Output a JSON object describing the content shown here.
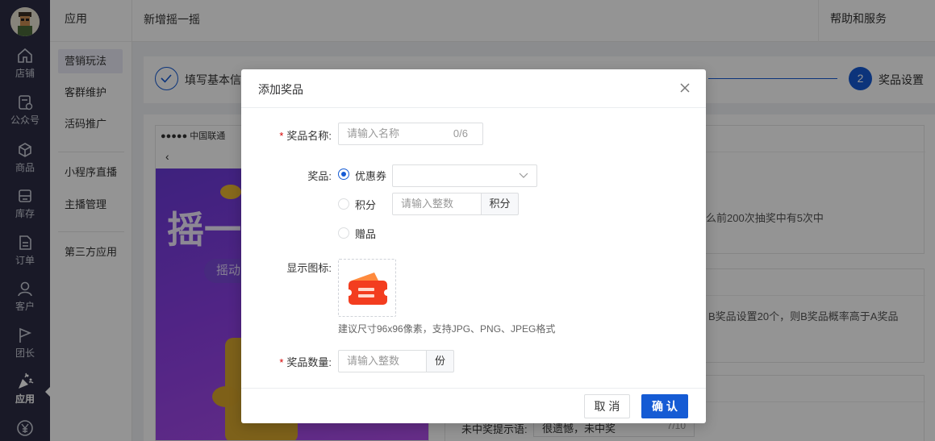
{
  "rail": {
    "items": [
      {
        "label": "店铺",
        "icon": "home-icon"
      },
      {
        "label": "公众号",
        "icon": "official-account-icon"
      },
      {
        "label": "商品",
        "icon": "cube-icon"
      },
      {
        "label": "库存",
        "icon": "inventory-icon"
      },
      {
        "label": "订单",
        "icon": "order-icon"
      },
      {
        "label": "客户",
        "icon": "customer-icon"
      },
      {
        "label": "团长",
        "icon": "flag-icon"
      },
      {
        "label": "应用",
        "icon": "party-popper-icon"
      }
    ],
    "active": "应用"
  },
  "submenu": {
    "header": "应用",
    "items": [
      "营销玩法",
      "客群维护",
      "活码推广",
      "小程序直播",
      "主播管理",
      "第三方应用"
    ],
    "active": "营销玩法"
  },
  "header": {
    "title": "新增摇一摇",
    "help": "帮助和服务"
  },
  "steps": {
    "step1_label": "填写基本信",
    "step2_number": "2",
    "step2_label": "奖品设置"
  },
  "preview": {
    "status_carrier": "●●●●● 中国联通",
    "banner_text": "摇一",
    "banner_pill": "摇动"
  },
  "background_panels": {
    "text1": "么前200次抽奖中有5次中",
    "text2": "B奖品设置20个，则B奖品概率高于A奖品",
    "text3_label": "未中奖提示语:",
    "text3_value": "很遗憾，未中奖",
    "text3_count": "7/10"
  },
  "modal": {
    "title": "添加奖品",
    "name_label": "奖品名称:",
    "name_placeholder": "请输入名称",
    "name_count": "0/6",
    "prize_label": "奖品:",
    "options": [
      "优惠券",
      "积分",
      "赠品"
    ],
    "selected_option": "优惠券",
    "points_placeholder": "请输入整数",
    "points_addon": "积分",
    "icon_label": "显示图标:",
    "icon_hint": "建议尺寸96x96像素，支持JPG、PNG、JPEG格式",
    "qty_label": "奖品数量:",
    "qty_placeholder": "请输入整数",
    "qty_addon": "份",
    "cancel": "取 消",
    "confirm": "确 认"
  },
  "colors": {
    "rail": "#2b2c44",
    "primary": "#155bd4",
    "required": "#d40000"
  }
}
